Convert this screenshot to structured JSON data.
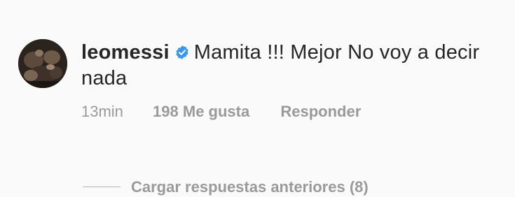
{
  "comment": {
    "username": "leomessi",
    "verified": true,
    "text": "Mamita !!! Mejor No voy a decir nada",
    "time": "13min",
    "likes": "198 Me gusta",
    "reply_label": "Responder",
    "load_replies_label": "Cargar respuestas anteriores (8)"
  },
  "icons": {
    "verified": "verified-badge-icon",
    "avatar": "profile-photo"
  },
  "colors": {
    "text_primary": "#262626",
    "text_secondary": "#9a9a9a",
    "verified_blue": "#3897f0",
    "background": "#fafafa"
  }
}
